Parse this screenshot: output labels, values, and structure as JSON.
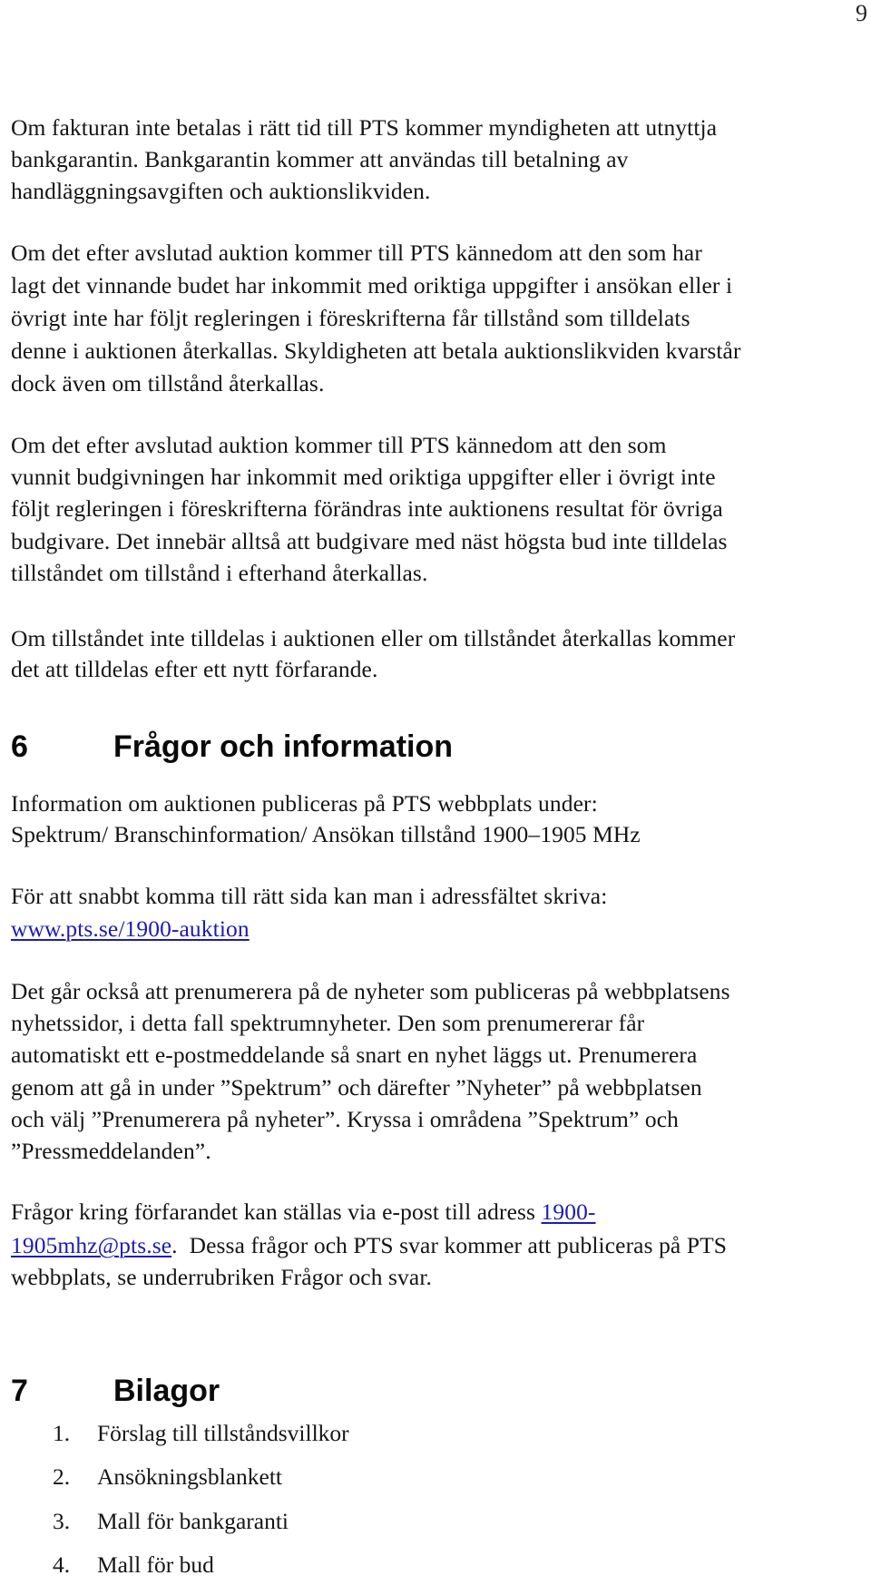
{
  "page_number": "9",
  "paragraphs": {
    "p1": [
      "Om fakturan inte betalas i rätt tid till PTS kommer myndigheten att utnyttja",
      "bankgarantin. Bankgarantin kommer att användas till betalning av",
      "handläggningsavgiften och auktionslikviden."
    ],
    "p2": [
      "Om det efter avslutad auktion kommer till PTS kännedom att den som har",
      "lagt det vinnande budet har inkommit med oriktiga uppgifter i ansökan eller i",
      "övrigt inte har följt regleringen i föreskrifterna får tillstånd som tilldelats",
      "denne i auktionen återkallas. Skyldigheten att betala auktionslikviden kvarstår",
      "dock även om tillstånd återkallas."
    ],
    "p3": [
      "Om det efter avslutad auktion kommer till PTS kännedom att den som",
      "vunnit budgivningen har inkommit med oriktiga uppgifter eller i övrigt inte",
      "följt regleringen i föreskrifterna förändras inte auktionens resultat för övriga",
      "budgivare. Det innebär alltså att budgivare med näst högsta bud inte tilldelas",
      "tillståndet om tillstånd i efterhand återkallas."
    ],
    "p4": [
      "Om tillståndet inte tilldelas i auktionen eller om tillståndet återkallas kommer",
      "det att tilldelas efter ett nytt förfarande."
    ]
  },
  "section6": {
    "number": "6",
    "title": "Frågor och information",
    "p1": [
      "Information om auktionen publiceras på PTS webbplats under:",
      "Spektrum/ Branschinformation/ Ansökan tillstånd 1900–1905 MHz"
    ],
    "p2_line1": "För att snabbt komma till rätt sida kan man i adressfältet skriva:",
    "url_link": "www.pts.se/1900-auktion",
    "p3": [
      "Det går också att prenumerera på de nyheter som publiceras på webbplatsens",
      "nyhetssidor, i detta fall spektrumnyheter. Den som prenumererar får",
      "automatiskt ett e-postmeddelande så snart en nyhet läggs ut. Prenumerera",
      "genom att gå in under ”Spektrum” och därefter ”Nyheter” på webbplatsen",
      "och välj ”Prenumerera på nyheter”. Kryssa i områdena ”Spektrum” och",
      "”Pressmeddelanden”."
    ],
    "p4": {
      "line1_text": "Frågor kring förfarandet kan ställas via e-post till adress ",
      "email_part1": "1900-",
      "email_part2": "1905mhz@pts.se",
      "line2_rest": ".  Dessa frågor och PTS svar kommer att publiceras på PTS",
      "line3": "webbplats, se underrubriken Frågor och svar."
    }
  },
  "section7": {
    "number": "7",
    "title": "Bilagor",
    "items": [
      {
        "num": "1.",
        "label": "Förslag till tillståndsvillkor"
      },
      {
        "num": "2.",
        "label": "Ansökningsblankett"
      },
      {
        "num": "3.",
        "label": "Mall för bankgaranti"
      },
      {
        "num": "4.",
        "label": "Mall för bud"
      }
    ]
  },
  "colors": {
    "text": "#151515",
    "link": "#1c1cb2"
  }
}
